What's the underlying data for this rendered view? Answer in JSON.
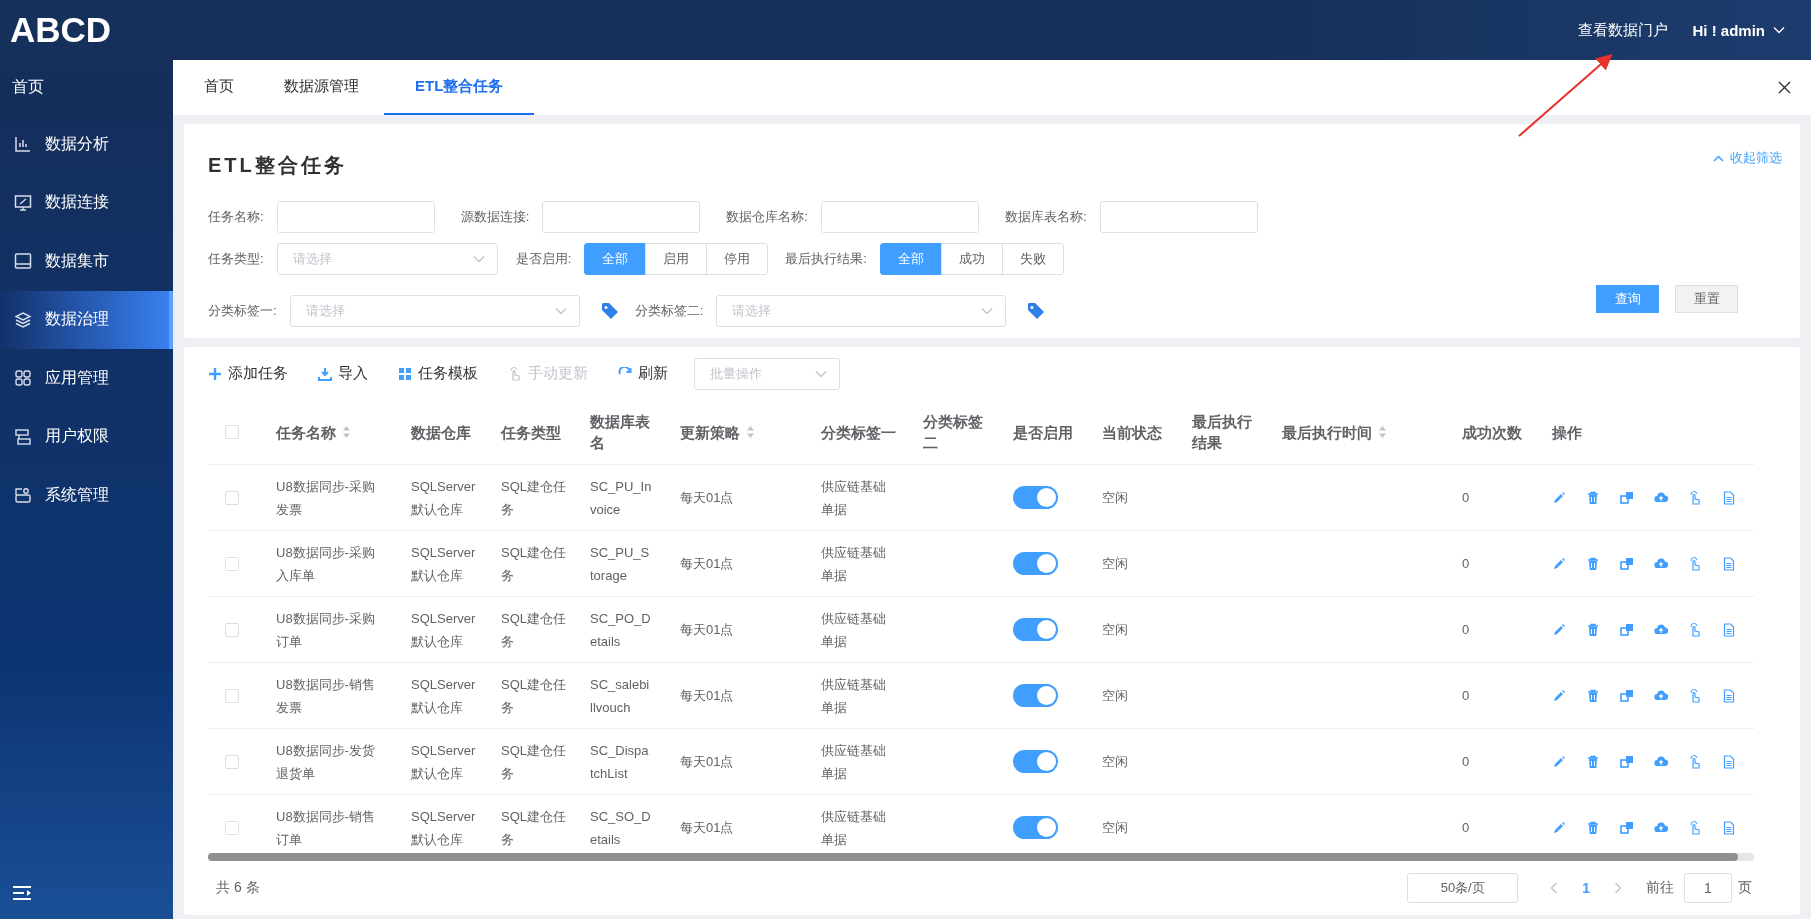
{
  "header": {
    "logo": "ABCD",
    "portal_link": "查看数据门户",
    "user": "Hi ! admin"
  },
  "sidebar": {
    "home": "首页",
    "items": [
      {
        "label": "数据分析",
        "selected": false
      },
      {
        "label": "数据连接",
        "selected": false
      },
      {
        "label": "数据集市",
        "selected": false
      },
      {
        "label": "数据治理",
        "selected": true
      },
      {
        "label": "应用管理",
        "selected": false
      },
      {
        "label": "用户权限",
        "selected": false
      },
      {
        "label": "系统管理",
        "selected": false
      }
    ]
  },
  "tabs": [
    {
      "label": "首页",
      "selected": false
    },
    {
      "label": "数据源管理",
      "selected": false
    },
    {
      "label": "ETL整合任务",
      "selected": true
    }
  ],
  "filter": {
    "title": "ETL整合任务",
    "collapse": "收起筛选",
    "text_fields": [
      {
        "label": "任务名称:"
      },
      {
        "label": "源数据连接:"
      },
      {
        "label": "数据仓库名称:"
      },
      {
        "label": "数据库表名称:"
      }
    ],
    "task_type": {
      "label": "任务类型:",
      "placeholder": "请选择"
    },
    "segments": [
      {
        "label": "是否启用:",
        "options": [
          {
            "label": "全部",
            "selected": true
          },
          {
            "label": "启用",
            "selected": false
          },
          {
            "label": "停用",
            "selected": false
          }
        ]
      },
      {
        "label": "最后执行结果:",
        "options": [
          {
            "label": "全部",
            "selected": true
          },
          {
            "label": "成功",
            "selected": false
          },
          {
            "label": "失败",
            "selected": false
          }
        ]
      }
    ],
    "tag_selects": [
      {
        "label": "分类标签一:",
        "placeholder": "请选择"
      },
      {
        "label": "分类标签二:",
        "placeholder": "请选择"
      }
    ],
    "buttons": [
      {
        "label": "查询",
        "kind": "primary"
      },
      {
        "label": "重置",
        "kind": "default"
      }
    ]
  },
  "toolbar": {
    "actions": [
      {
        "label": "添加任务",
        "disabled": false
      },
      {
        "label": "导入",
        "disabled": false
      },
      {
        "label": "任务模板",
        "disabled": false
      },
      {
        "label": "手动更新",
        "disabled": true
      },
      {
        "label": "刷新",
        "disabled": false
      }
    ],
    "batch": {
      "placeholder": "批量操作"
    }
  },
  "table": {
    "select_all": {
      "checked": false
    },
    "columns": [
      {
        "label": "任务名称",
        "sortable": true
      },
      {
        "label": "数据仓库",
        "sortable": false
      },
      {
        "label": "任务类型",
        "sortable": false
      },
      {
        "label": "数据库表名",
        "sortable": false
      },
      {
        "label": "更新策略",
        "sortable": true
      },
      {
        "label": "分类标签一",
        "sortable": false
      },
      {
        "label": "分类标签二",
        "sortable": false
      },
      {
        "label": "是否启用",
        "sortable": false
      },
      {
        "label": "当前状态",
        "sortable": false
      },
      {
        "label": "最后执行结果",
        "sortable": false
      },
      {
        "label": "最后执行时间",
        "sortable": true
      },
      {
        "label": "成功次数",
        "sortable": false
      },
      {
        "label": "操作",
        "sortable": false
      }
    ],
    "rows": [
      {
        "checked": false,
        "name": "U8数据同步-采购发票",
        "warehouse": "SQLServer默认仓库",
        "type": "SQL建仓任务",
        "table_name": "SC_PU_Invoice",
        "strategy": "每天01点",
        "tag1": "供应链基础单据",
        "enabled": true,
        "status": "空闲",
        "count": "0"
      },
      {
        "checked": false,
        "name": "U8数据同步-采购入库单",
        "warehouse": "SQLServer默认仓库",
        "type": "SQL建仓任务",
        "table_name": "SC_PU_Storage",
        "strategy": "每天01点",
        "tag1": "供应链基础单据",
        "enabled": true,
        "status": "空闲",
        "count": "0"
      },
      {
        "checked": false,
        "name": "U8数据同步-采购订单",
        "warehouse": "SQLServer默认仓库",
        "type": "SQL建仓任务",
        "table_name": "SC_PO_Details",
        "strategy": "每天01点",
        "tag1": "供应链基础单据",
        "enabled": true,
        "status": "空闲",
        "count": "0"
      },
      {
        "checked": false,
        "name": "U8数据同步-销售发票",
        "warehouse": "SQLServer默认仓库",
        "type": "SQL建仓任务",
        "table_name": "SC_salebillvouch",
        "strategy": "每天01点",
        "tag1": "供应链基础单据",
        "enabled": true,
        "status": "空闲",
        "count": "0"
      },
      {
        "checked": false,
        "name": "U8数据同步-发货退货单",
        "warehouse": "SQLServer默认仓库",
        "type": "SQL建仓任务",
        "table_name": "SC_DispatchList",
        "strategy": "每天01点",
        "tag1": "供应链基础单据",
        "enabled": true,
        "status": "空闲",
        "count": "0"
      },
      {
        "checked": false,
        "name": "U8数据同步-销售订单",
        "warehouse": "SQLServer默认仓库",
        "type": "SQL建仓任务",
        "table_name": "SC_SO_Details",
        "strategy": "每天01点",
        "tag1": "供应链基础单据",
        "enabled": true,
        "status": "空闲",
        "count": "0"
      }
    ]
  },
  "pagination": {
    "total": "共 6 条",
    "page_size": "50条/页",
    "pages": [
      {
        "label": "1",
        "selected": true
      }
    ],
    "goto_label": "前往",
    "goto_value": "1",
    "goto_suffix": "页"
  }
}
